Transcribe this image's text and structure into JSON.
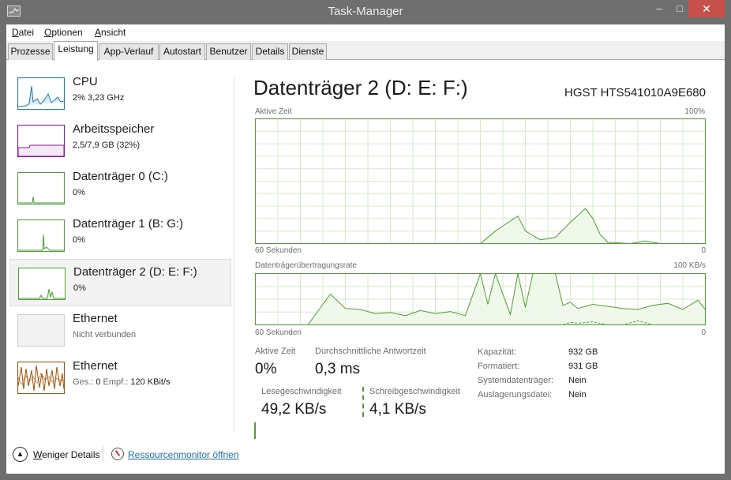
{
  "window": {
    "title": "Task-Manager",
    "minimize": "–",
    "maximize": "□",
    "close": "✕"
  },
  "menubar": [
    {
      "accel": "D",
      "rest": "atei"
    },
    {
      "accel": "O",
      "rest": "ptionen"
    },
    {
      "accel": "A",
      "rest": "nsicht"
    }
  ],
  "tabs": [
    "Prozesse",
    "Leistung",
    "App-Verlauf",
    "Autostart",
    "Benutzer",
    "Details",
    "Dienste"
  ],
  "active_tab": "Leistung",
  "sidebar": [
    {
      "title": "CPU",
      "sub": "2% 3,23 GHz",
      "color": "#117dbb"
    },
    {
      "title": "Arbeitsspeicher",
      "sub": "2,5/7,9 GB (32%)",
      "color": "#8b12ae"
    },
    {
      "title": "Datenträger 0 (C:)",
      "sub": "0%",
      "color": "#4da033"
    },
    {
      "title": "Datenträger 1 (B: G:)",
      "sub": "0%",
      "color": "#4da033"
    },
    {
      "title": "Datenträger 2 (D: E: F:)",
      "sub": "0%",
      "color": "#4da033",
      "selected": true
    },
    {
      "title": "Ethernet",
      "sub": "Nicht verbunden",
      "color": "#a7a7a7"
    },
    {
      "title": "Ethernet",
      "sub_prefix": "Ges.: ",
      "sub_a": "0",
      "sub_mid": " Empf.: ",
      "sub_b": "120 KBit/s",
      "color": "#a74f01"
    }
  ],
  "main": {
    "title": "Datenträger 2 (D: E: F:)",
    "model": "HGST HTS541010A9E680",
    "chart1": {
      "label": "Aktive Zeit",
      "max": "100%",
      "time": "60 Sekunden",
      "zero": "0"
    },
    "chart2": {
      "label": "Datenträgerübertragungsrate",
      "max": "100 KB/s",
      "time": "60 Sekunden",
      "zero": "0"
    },
    "stats": {
      "active_label": "Aktive Zeit",
      "active_value": "0%",
      "resp_label": "Durchschnittliche Antwortzeit",
      "resp_value": "0,3 ms",
      "read_label": "Lesegeschwindigkeit",
      "read_value": "49,2 KB/s",
      "write_label": "Schreibgeschwindigkeit",
      "write_value": "4,1 KB/s"
    },
    "props": [
      {
        "label": "Kapazität:",
        "value": "932 GB"
      },
      {
        "label": "Formatiert:",
        "value": "931 GB"
      },
      {
        "label": "Systemdatenträger:",
        "value": "Nein"
      },
      {
        "label": "Auslagerungsdatei:",
        "value": "Nein"
      }
    ]
  },
  "footer": {
    "less_accel": "W",
    "less_rest": "eniger Details",
    "resource_monitor": "Ressourcenmonitor öffnen"
  },
  "colors": {
    "disk": "#4da033",
    "disk_fill": "#eef7e9",
    "cpu": "#117dbb",
    "memory": "#8b12ae",
    "ethernet": "#a74f01",
    "link": "#1a6fc6",
    "close": "#c7504a"
  },
  "chart_data": [
    {
      "type": "area",
      "title": "Aktive Zeit",
      "ylim": [
        0,
        100
      ],
      "x": [
        -60,
        -45,
        -30,
        -28,
        -25,
        -24,
        -22,
        -20,
        -18,
        -16,
        -15,
        -14,
        -13,
        -10,
        -8,
        -6,
        -5,
        -3,
        0
      ],
      "series": [
        {
          "values": [
            0,
            0,
            0,
            10,
            22,
            10,
            3,
            5,
            17,
            28,
            20,
            7,
            1,
            0,
            2,
            0,
            0,
            0,
            0
          ]
        }
      ]
    },
    {
      "type": "area",
      "title": "Datenträgerübertragungsrate",
      "ylim": [
        0,
        100
      ],
      "x": [
        -60,
        -55,
        -53,
        -51,
        -50,
        -48,
        -46,
        -44,
        -42,
        -40,
        -38,
        -36,
        -34,
        -32,
        -30,
        -29,
        -28,
        -26,
        -25,
        -24,
        -23,
        -22,
        -21,
        -20,
        -19,
        -18,
        -17,
        -15,
        -13,
        -11,
        -9,
        -7,
        -5,
        -3,
        -1,
        0
      ],
      "series": [
        {
          "values": [
            0,
            0,
            0,
            40,
            60,
            32,
            30,
            22,
            24,
            18,
            28,
            22,
            26,
            18,
            100,
            40,
            100,
            20,
            100,
            34,
            100,
            100,
            100,
            100,
            38,
            44,
            32,
            40,
            36,
            32,
            30,
            38,
            42,
            30,
            48,
            30
          ]
        },
        {
          "values": [
            0,
            0,
            0,
            0,
            0,
            0,
            0,
            0,
            0,
            0,
            0,
            0,
            0,
            0,
            0,
            0,
            0,
            0,
            0,
            0,
            0,
            0,
            0,
            0,
            0,
            5,
            3,
            6,
            0,
            0,
            8,
            0,
            0,
            0,
            0,
            0
          ]
        }
      ]
    }
  ]
}
